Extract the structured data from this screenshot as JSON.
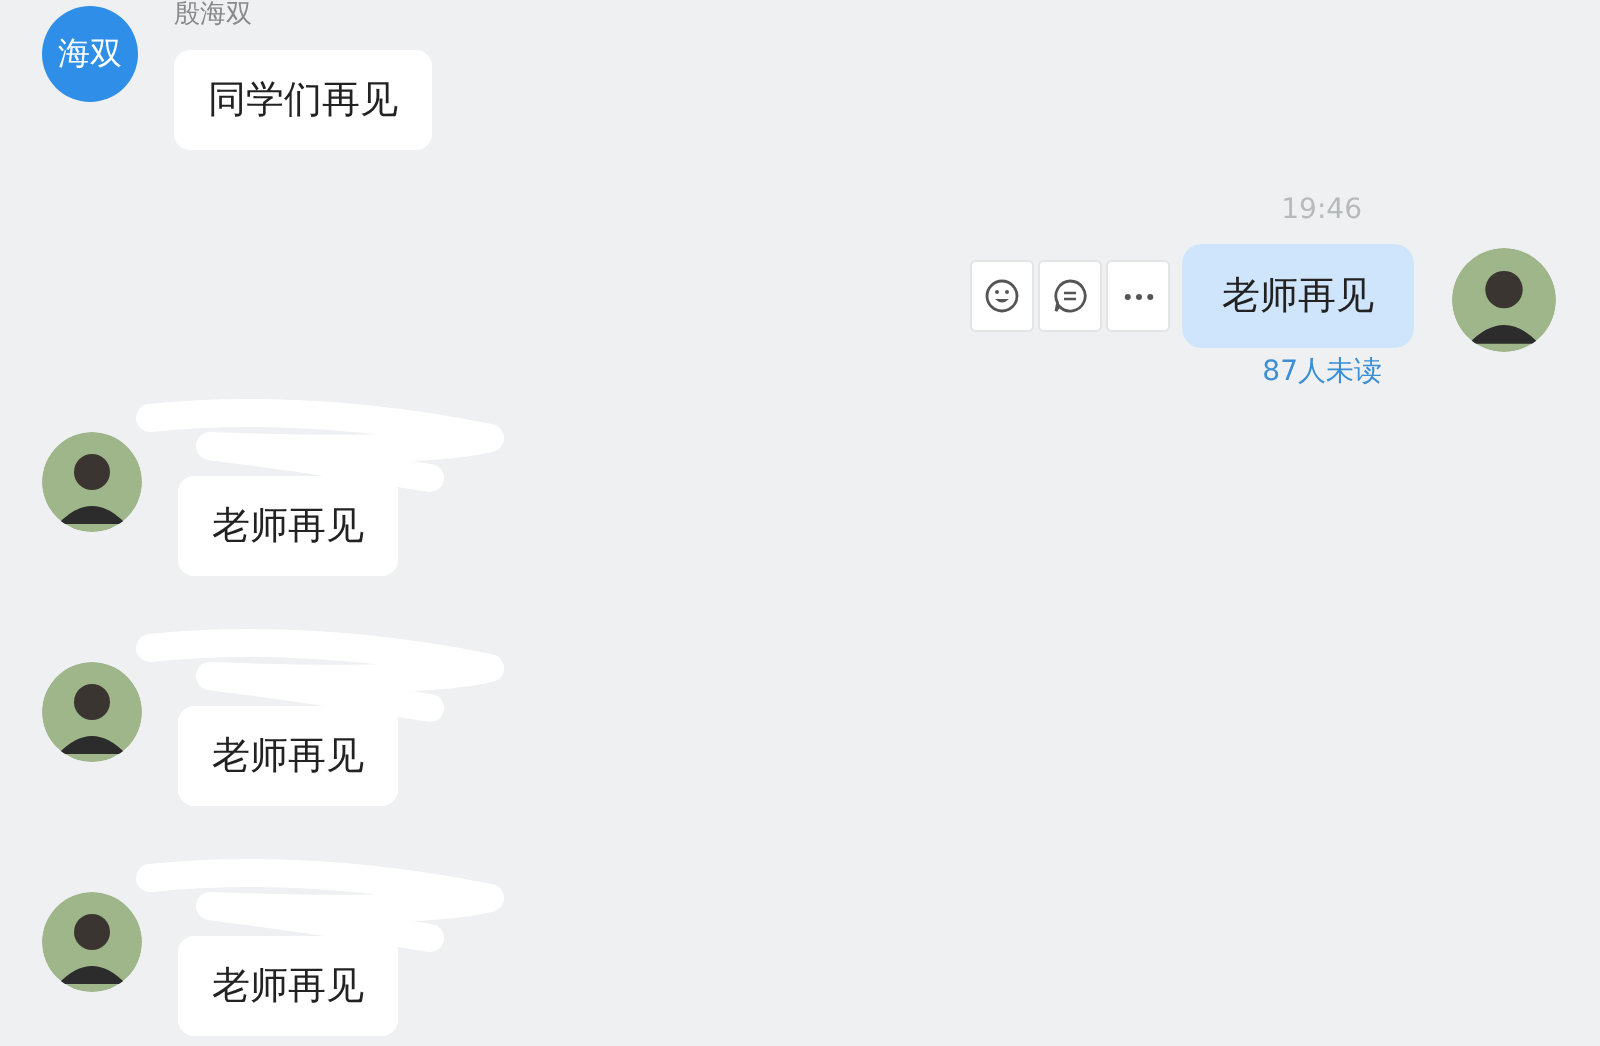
{
  "messages": [
    {
      "kind": "incoming",
      "avatar": {
        "kind": "initials",
        "text": "海双"
      },
      "sender": "殷海双",
      "sender_redacted": false,
      "text": "同学们再见"
    },
    {
      "kind": "outgoing",
      "time": "19:46",
      "avatar": {
        "kind": "photo"
      },
      "text": "老师再见",
      "read_status": "87人未读",
      "actions": [
        {
          "kind": "emoji"
        },
        {
          "kind": "reply"
        },
        {
          "kind": "more"
        }
      ]
    },
    {
      "kind": "incoming",
      "avatar": {
        "kind": "photo"
      },
      "sender_redacted": true,
      "text": "老师再见"
    },
    {
      "kind": "incoming",
      "avatar": {
        "kind": "photo"
      },
      "sender_redacted": true,
      "text": "老师再见"
    },
    {
      "kind": "incoming",
      "avatar": {
        "kind": "photo"
      },
      "sender_redacted": true,
      "text": "老师再见"
    }
  ]
}
